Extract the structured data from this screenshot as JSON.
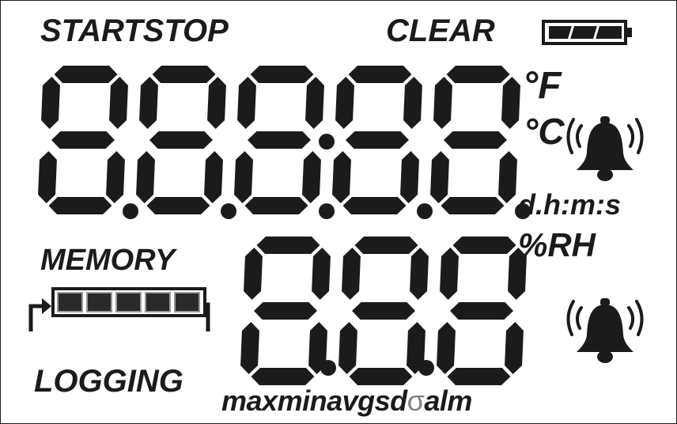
{
  "top_bar": {
    "start": "START",
    "stop": "STOP",
    "clear": "CLEAR"
  },
  "battery": {
    "icon": "battery-icon",
    "segments_shown": 3
  },
  "main_display": {
    "digits": 5,
    "decimal_points": 5,
    "colon": true
  },
  "secondary_display": {
    "digits": 3,
    "decimal_points": 2
  },
  "units": {
    "fahrenheit": "°F",
    "celsius": "°C",
    "time": "d.h:m:s",
    "humidity": "%RH"
  },
  "memory": {
    "label": "MEMORY",
    "segments": 5
  },
  "logging": {
    "label": "LOGGING",
    "icon": "loop-arrow-icon"
  },
  "alarms": {
    "icons": [
      "alarm-bell-icon",
      "alarm-bell-icon"
    ]
  },
  "stats": {
    "max": "max",
    "min": "min",
    "avg": "avg",
    "sd": "sd",
    "sigma": "σ",
    "alm": "alm"
  },
  "colors": {
    "segment": "#1b1b1b",
    "background": "#ffffff",
    "sigma": "#808080"
  }
}
